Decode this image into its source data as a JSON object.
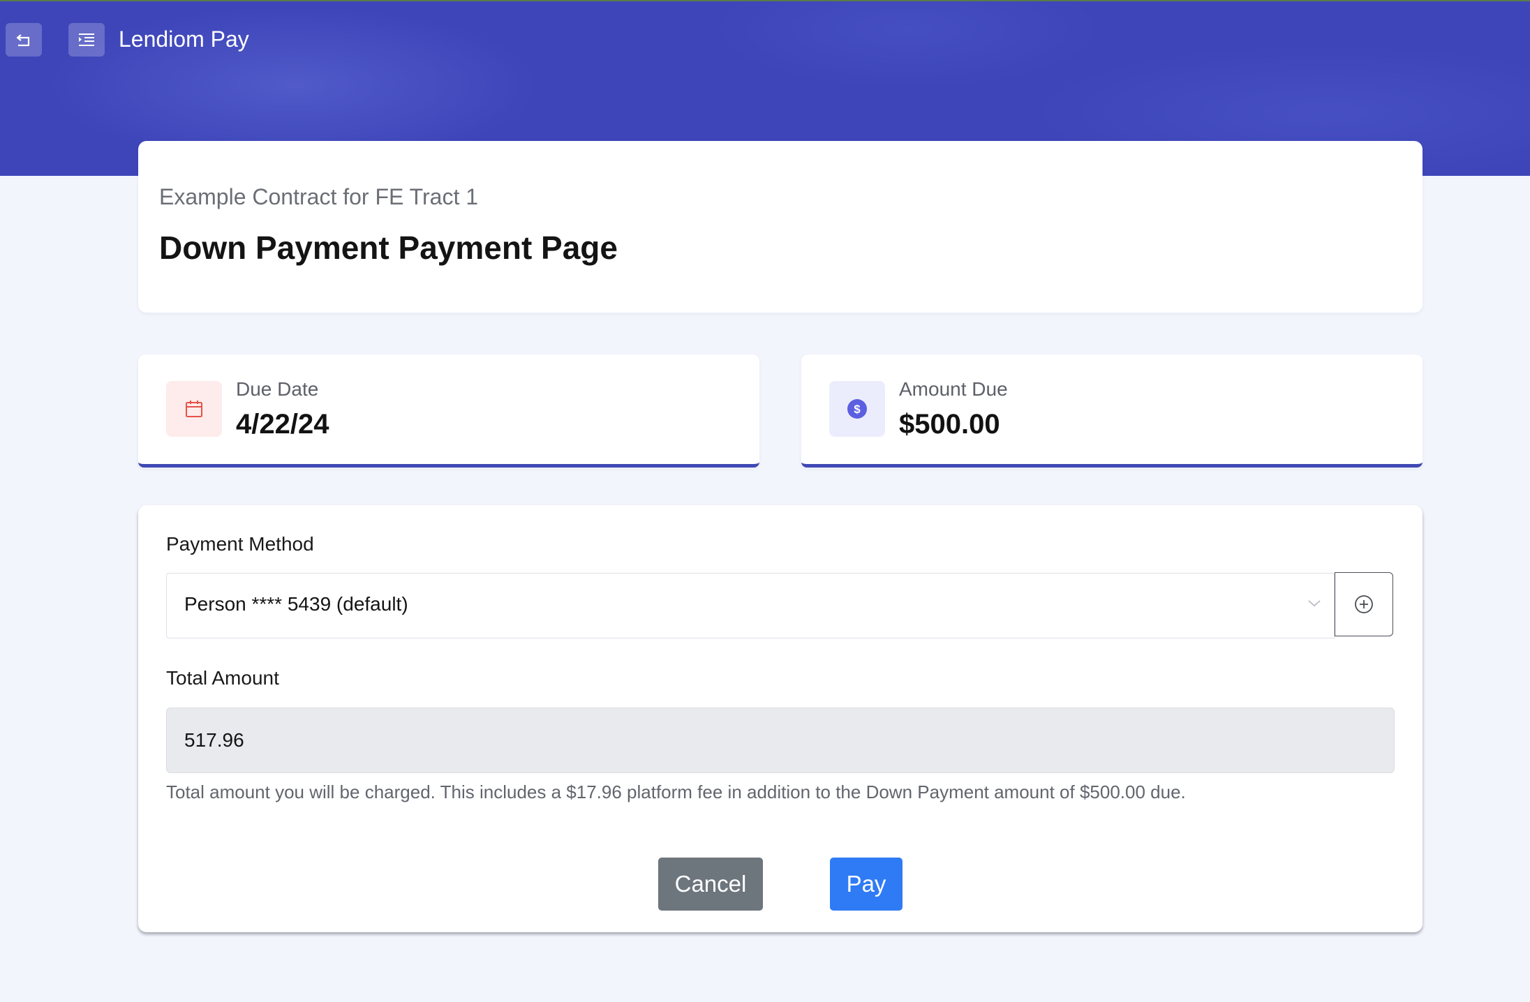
{
  "header": {
    "app_title": "Lendiom Pay",
    "back_icon": "back-arrow-icon",
    "menu_icon": "menu-indent-icon"
  },
  "page": {
    "contract_name": "Example Contract for FE Tract 1",
    "title": "Down Payment Payment Page"
  },
  "stats": {
    "due_date": {
      "label": "Due Date",
      "value": "4/22/24",
      "icon": "calendar-icon",
      "icon_color": "#e5524a"
    },
    "amount_due": {
      "label": "Amount Due",
      "value": "$500.00",
      "icon": "dollar-circle-icon",
      "icon_color": "#5b5fe0"
    }
  },
  "form": {
    "payment_method_label": "Payment Method",
    "payment_method_value": "Person **** 5439 (default)",
    "total_amount_label": "Total Amount",
    "total_amount_value": "517.96",
    "help_text": "Total amount you will be charged. This includes a $17.96 platform fee in addition to the Down Payment amount of $500.00 due.",
    "cancel_label": "Cancel",
    "pay_label": "Pay"
  },
  "colors": {
    "brand": "#3d45b9",
    "accent_border": "#3f48b3",
    "pay_button": "#2f7bf5",
    "cancel_button": "#6d757d"
  }
}
